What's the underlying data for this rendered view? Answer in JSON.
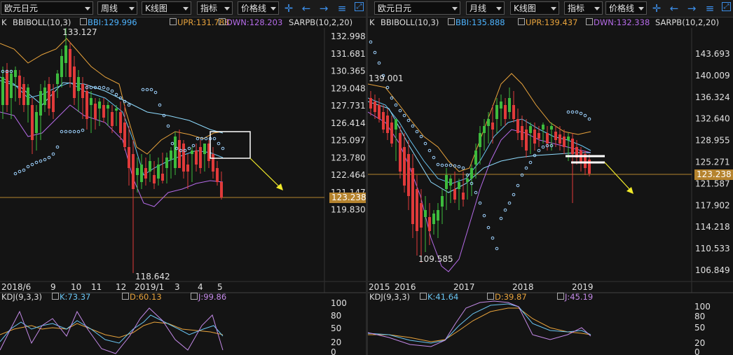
{
  "colors": {
    "up": "#3dbb3d",
    "down": "#e03a3a",
    "bbi": "#4db3ff",
    "upr": "#e8a33c",
    "dwn": "#b56be8",
    "sar": "#9fd3ff",
    "k": "#6ac5f2",
    "d": "#e8a33c",
    "j": "#c48ae8",
    "price_line": "#b5832e",
    "arrow": "#f1ea2a",
    "accent": "#3c8ee8"
  },
  "left": {
    "toolbar": {
      "symbol": "欧元日元",
      "period": "周线",
      "chart_type": "K线图",
      "indicator": "指标",
      "price_line": "价格线",
      "icons": [
        "crosshair-icon",
        "back-icon",
        "forward-icon",
        "list-icon",
        "expand-icon"
      ]
    },
    "legend": {
      "k": "K",
      "bboll": "BBIBOLL(10,3)",
      "bbi": "BBI:129.996",
      "upr": "UPR:131.788",
      "dwn": "DWN:128.203",
      "sar": "SARPB(10,2,20)"
    },
    "y_ticks": [
      "132.998",
      "131.681",
      "130.365",
      "129.048",
      "127.731",
      "126.414",
      "125.097",
      "123.780",
      "122.464",
      "121.147",
      "119.830"
    ],
    "x_ticks": [
      "2018/6",
      "9",
      "10",
      "11",
      "12",
      "2019/1",
      "3",
      "4",
      "5"
    ],
    "annotations": {
      "high": "133.127",
      "low": "118.642"
    },
    "current_price": "123.238",
    "kdj": {
      "title": "KDJ(9,3,3)",
      "k": "K:73.37",
      "d": "D:60.13",
      "j": "J:99.86",
      "ticks": [
        "100",
        "80",
        "50",
        "20",
        "0"
      ]
    }
  },
  "right": {
    "toolbar": {
      "symbol": "欧元日元",
      "period": "月线",
      "chart_type": "K线图",
      "indicator": "指标",
      "price_line": "价格线",
      "icons": [
        "crosshair-icon",
        "back-icon",
        "forward-icon",
        "list-icon",
        "expand-icon"
      ]
    },
    "legend": {
      "k": "K",
      "bboll": "BBIBOLL(10,3)",
      "bbi": "BBI:135.888",
      "upr": "UPR:139.437",
      "dwn": "DWN:132.338",
      "sar": "SARPB(10,2,20)"
    },
    "y_ticks": [
      "143.693",
      "140.009",
      "136.324",
      "132.640",
      "128.955",
      "125.271",
      "121.587",
      "117.902",
      "114.218",
      "110.533",
      "106.849"
    ],
    "x_ticks": [
      "2015",
      "2016",
      "2017",
      "2018",
      "2019"
    ],
    "annotations": {
      "high": "139.001",
      "low": "109.585"
    },
    "current_price": "123.238",
    "kdj": {
      "title": "KDJ(9,3,3)",
      "k": "K:41.64",
      "d": "D:39.87",
      "j": "J:45.19",
      "ticks": [
        "100",
        "80",
        "50",
        "20",
        "0"
      ]
    }
  }
}
